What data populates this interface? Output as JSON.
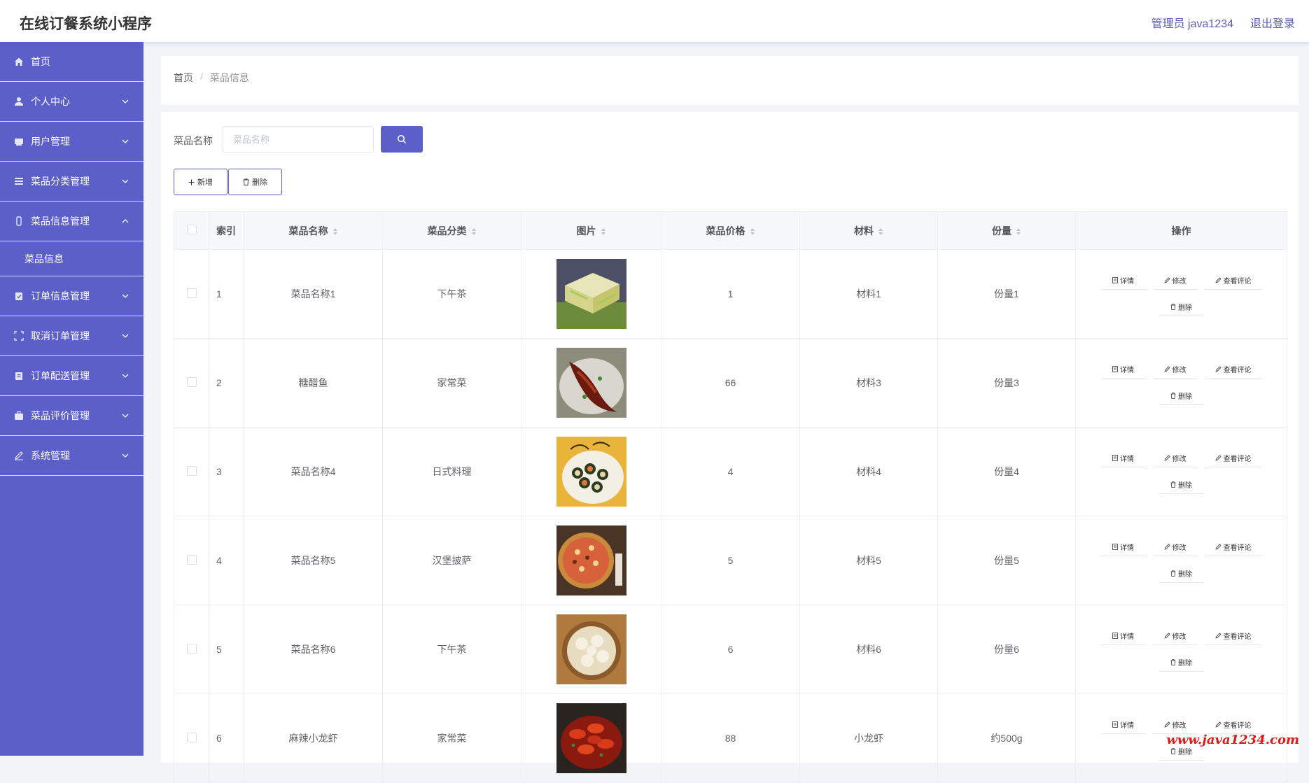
{
  "header": {
    "app_title": "在线订餐系统小程序",
    "admin_name": "管理员 java1234",
    "logout_label": "退出登录"
  },
  "sidebar": {
    "items": [
      {
        "label": "首页",
        "icon": "home-icon",
        "expandable": false
      },
      {
        "label": "个人中心",
        "icon": "user-icon",
        "expandable": true
      },
      {
        "label": "用户管理",
        "icon": "users-icon",
        "expandable": true
      },
      {
        "label": "菜品分类管理",
        "icon": "list-icon",
        "expandable": true
      },
      {
        "label": "菜品信息管理",
        "icon": "phone-icon",
        "expandable": true,
        "expanded": true
      },
      {
        "label": "订单信息管理",
        "icon": "clipboard-icon",
        "expandable": true
      },
      {
        "label": "取消订单管理",
        "icon": "frame-icon",
        "expandable": true
      },
      {
        "label": "订单配送管理",
        "icon": "clipboard-icon",
        "expandable": true
      },
      {
        "label": "菜品评价管理",
        "icon": "briefcase-icon",
        "expandable": true
      },
      {
        "label": "系统管理",
        "icon": "pen-icon",
        "expandable": true
      }
    ],
    "submenu": {
      "label": "菜品信息"
    }
  },
  "breadcrumb": {
    "home": "首页",
    "separator": "/",
    "current": "菜品信息"
  },
  "search": {
    "label": "菜品名称",
    "placeholder": "菜品名称"
  },
  "toolbar": {
    "add_label": "新增",
    "delete_label": "删除"
  },
  "table": {
    "columns": [
      "索引",
      "菜品名称",
      "菜品分类",
      "图片",
      "菜品价格",
      "材料",
      "份量",
      "操作"
    ],
    "actions": {
      "detail": "详情",
      "edit": "修改",
      "view_comments": "查看评论",
      "delete": "删除"
    },
    "rows": [
      {
        "index": "1",
        "name": "菜品名称1",
        "category": "下午茶",
        "price": "1",
        "material": "材料1",
        "portion": "份量1"
      },
      {
        "index": "2",
        "name": "糖醋鱼",
        "category": "家常菜",
        "price": "66",
        "material": "材料3",
        "portion": "份量3"
      },
      {
        "index": "3",
        "name": "菜品名称4",
        "category": "日式料理",
        "price": "4",
        "material": "材料4",
        "portion": "份量4"
      },
      {
        "index": "4",
        "name": "菜品名称5",
        "category": "汉堡披萨",
        "price": "5",
        "material": "材料5",
        "portion": "份量5"
      },
      {
        "index": "5",
        "name": "菜品名称6",
        "category": "下午茶",
        "price": "6",
        "material": "材料6",
        "portion": "份量6"
      },
      {
        "index": "6",
        "name": "麻辣小龙虾",
        "category": "家常菜",
        "price": "88",
        "material": "小龙虾",
        "portion": "约500g"
      }
    ]
  },
  "watermark": "www.java1234.com",
  "colors": {
    "primary": "#5b5fc7",
    "watermark": "#e01818"
  }
}
